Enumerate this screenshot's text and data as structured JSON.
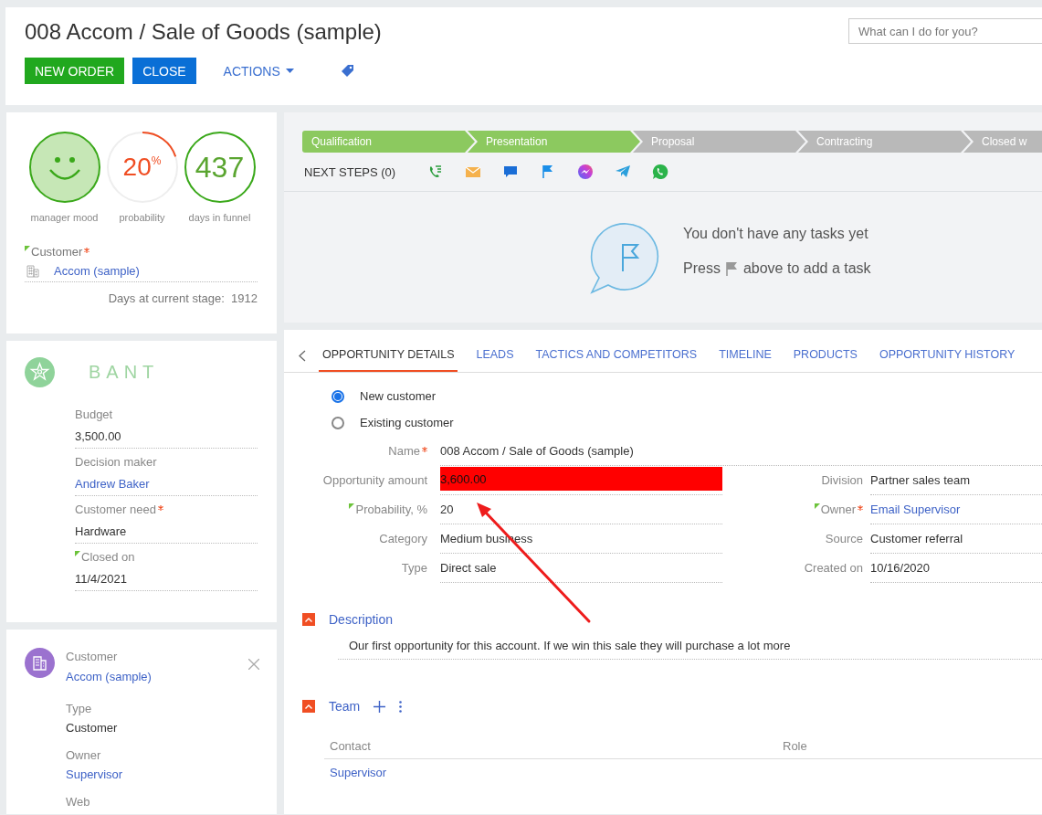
{
  "header": {
    "title": "008 Accom / Sale of Goods (sample)",
    "search": {
      "placeholder": "What can I do for you?"
    },
    "buttons": [
      {
        "kind": "green",
        "label": "NEW ORDER"
      },
      {
        "kind": "blue",
        "label": "CLOSE"
      },
      {
        "kind": "menu",
        "label": "ACTIONS"
      },
      {
        "kind": "tag"
      }
    ]
  },
  "summary": {
    "metrics": [
      {
        "kind": "mood",
        "label": "manager mood"
      },
      {
        "kind": "gauge",
        "value": "20",
        "unit": "%",
        "level": 0.2,
        "label": "probability"
      },
      {
        "kind": "counter",
        "value": "437",
        "label": "days in funnel"
      }
    ],
    "customer": {
      "label": "Customer",
      "required": true,
      "flag": true,
      "value": "Accom (sample)"
    },
    "stage_days": "Days at current stage:  1912"
  },
  "bant": {
    "title": "BANT",
    "fields": [
      {
        "label": "Budget",
        "value": "3,500.00",
        "kind": "text",
        "required": false,
        "flag": false
      },
      {
        "label": "Decision maker",
        "value": "Andrew Baker",
        "kind": "link",
        "required": false,
        "flag": false
      },
      {
        "label": "Customer need",
        "value": "Hardware",
        "kind": "text",
        "required": true,
        "flag": false
      },
      {
        "label": "Closed on",
        "value": "11/4/2021",
        "kind": "text",
        "required": false,
        "flag": true
      }
    ]
  },
  "customer_card": {
    "label": "Customer",
    "value": "Accom (sample)",
    "fields": [
      {
        "label": "Type",
        "value": "Customer",
        "kind": "text"
      },
      {
        "label": "Owner",
        "value": "Supervisor",
        "kind": "link"
      },
      {
        "label": "Web",
        "kind": "empty"
      }
    ]
  },
  "pipeline": {
    "stages": [
      {
        "label": "Qualification",
        "completed": true
      },
      {
        "label": "Presentation",
        "completed": true
      },
      {
        "label": "Proposal",
        "completed": false
      },
      {
        "label": "Contracting",
        "completed": false
      },
      {
        "label": "Closed w",
        "completed": false
      }
    ],
    "next_steps": "NEXT STEPS (0)",
    "empty": {
      "title": "You don't have any tasks yet",
      "hint_before": "Press",
      "hint_after": "above to add a task"
    }
  },
  "details": {
    "tabs": [
      {
        "label": "OPPORTUNITY DETAILS",
        "selected": true
      },
      {
        "label": "LEADS",
        "selected": false
      },
      {
        "label": "TACTICS AND COMPETITORS",
        "selected": false
      },
      {
        "label": "TIMELINE",
        "selected": false
      },
      {
        "label": "PRODUCTS",
        "selected": false
      },
      {
        "label": "OPPORTUNITY HISTORY",
        "selected": false
      }
    ],
    "radios": [
      {
        "label": "New customer",
        "selected": true
      },
      {
        "label": "Existing customer",
        "selected": false
      }
    ],
    "name": {
      "label": "Name",
      "value": "008 Accom / Sale of Goods (sample)",
      "kind": "text",
      "required": true,
      "flag": false,
      "highlighted": false
    },
    "left": [
      {
        "label": "Opportunity amount",
        "value": "3,600.00",
        "kind": "text",
        "required": false,
        "flag": false,
        "highlighted": true
      },
      {
        "label": "Probability, %",
        "value": "20",
        "kind": "text",
        "required": false,
        "flag": true,
        "highlighted": false
      },
      {
        "label": "Category",
        "value": "Medium business",
        "kind": "text",
        "required": false,
        "flag": false,
        "highlighted": false
      },
      {
        "label": "Type",
        "value": "Direct sale",
        "kind": "text",
        "required": false,
        "flag": false,
        "highlighted": false
      }
    ],
    "right": [
      {
        "label": "Division",
        "value": "Partner sales team",
        "kind": "text",
        "required": false,
        "flag": false,
        "highlighted": false
      },
      {
        "label": "Owner",
        "value": "Email Supervisor",
        "kind": "link",
        "required": true,
        "flag": true,
        "highlighted": false
      },
      {
        "label": "Source",
        "value": "Customer referral",
        "kind": "text",
        "required": false,
        "flag": false,
        "highlighted": false
      },
      {
        "label": "Created on",
        "value": "10/16/2020",
        "kind": "text",
        "required": false,
        "flag": false,
        "highlighted": false
      }
    ],
    "description": {
      "title": "Description",
      "expanded": true,
      "text": "Our first opportunity for this account. If we win this sale they will purchase a lot more"
    },
    "team": {
      "title": "Team",
      "expanded": true,
      "columns": [
        "Contact",
        "Role"
      ],
      "rows": [
        {
          "contact": "Supervisor"
        }
      ]
    }
  }
}
